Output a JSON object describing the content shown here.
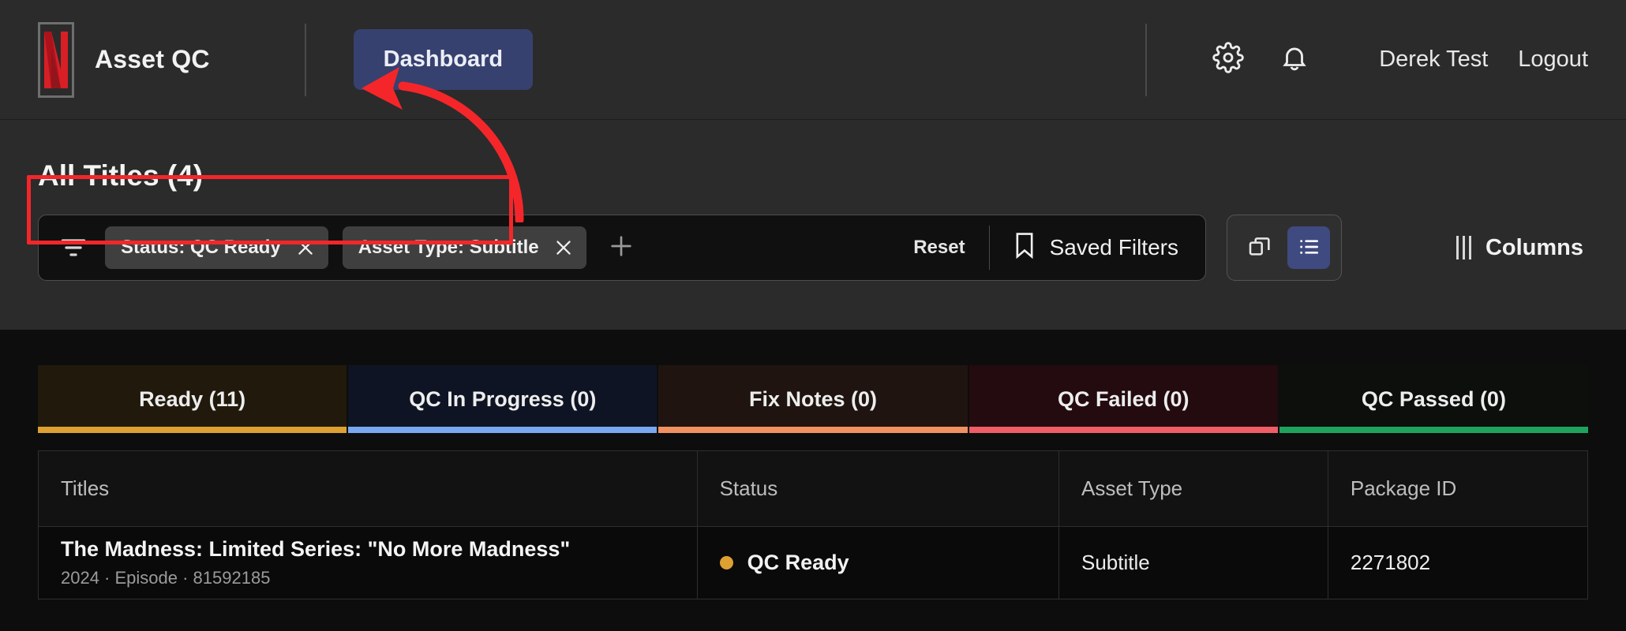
{
  "header": {
    "logo_icon": "netflix-n-logo",
    "app_title": "Asset QC",
    "nav": {
      "dashboard_label": "Dashboard"
    },
    "gear_icon": "gear-icon",
    "bell_icon": "bell-icon",
    "user_name": "Derek Test",
    "logout_label": "Logout",
    "accent_blue": "#37416f"
  },
  "page": {
    "title": "All Titles (4)"
  },
  "filters": {
    "funnel_icon": "filter-funnel-icon",
    "chips": [
      {
        "label": "Status: QC Ready",
        "remove_icon": "close-x-icon"
      },
      {
        "label": "Asset Type: Subtitle",
        "remove_icon": "close-x-icon"
      }
    ],
    "add_icon": "plus-icon",
    "reset_label": "Reset",
    "saved_filters_label": "Saved Filters",
    "saved_filters_icon": "bookmark-icon",
    "view_toggle": {
      "card_view_icon": "card-view-icon",
      "list_view_icon": "list-view-icon",
      "active": "list"
    },
    "columns_label": "Columns",
    "columns_icon": "columns-bars-icon",
    "annotation_color": "#f4262a"
  },
  "tabs": [
    {
      "label": "Ready (11)",
      "count": 11,
      "underline": "#dda033",
      "bg": "#211a0c",
      "active": true
    },
    {
      "label": "QC In Progress (0)",
      "count": 0,
      "underline": "#7aa7ef",
      "bg": "#0e1424",
      "active": false
    },
    {
      "label": "Fix Notes (0)",
      "count": 0,
      "underline": "#ef9161",
      "bg": "#1f1410",
      "active": false
    },
    {
      "label": "QC Failed (0)",
      "count": 0,
      "underline": "#ef5d66",
      "bg": "#230b0f",
      "active": false
    },
    {
      "label": "QC Passed (0)",
      "count": 0,
      "underline": "#1fa35c",
      "bg": "#0c0f0c",
      "active": false
    }
  ],
  "table": {
    "columns": [
      "Titles",
      "Status",
      "Asset Type",
      "Package ID"
    ],
    "rows": [
      {
        "title": "The Madness: Limited Series: \"No More Madness\"",
        "meta": "2024 · Episode · 81592185",
        "status": "QC Ready",
        "status_dot_color": "#dda033",
        "asset_type": "Subtitle",
        "package_id": "2271802"
      }
    ]
  }
}
